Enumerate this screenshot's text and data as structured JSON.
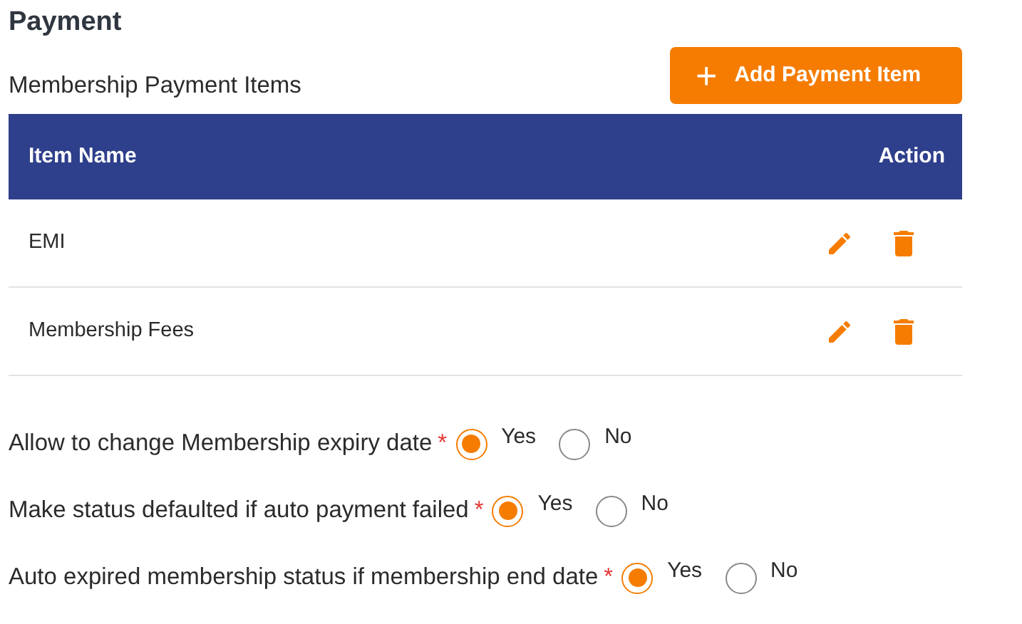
{
  "section_title": "Payment",
  "subtitle": "Membership Payment Items",
  "add_button": {
    "icon": "+",
    "label": "Add Payment Item"
  },
  "table": {
    "columns": [
      "Item Name",
      "Action"
    ],
    "rows": [
      {
        "name": "EMI"
      },
      {
        "name": "Membership Fees"
      }
    ]
  },
  "settings": [
    {
      "label": "Allow to change Membership expiry date",
      "required_mark": "*",
      "options": [
        {
          "label": "Yes",
          "selected": true
        },
        {
          "label": "No",
          "selected": false
        }
      ]
    },
    {
      "label": "Make status defaulted if auto payment failed",
      "required_mark": "*",
      "options": [
        {
          "label": "Yes",
          "selected": true
        },
        {
          "label": "No",
          "selected": false
        }
      ]
    },
    {
      "label": "Auto expired membership status if membership end date",
      "required_mark": "*",
      "options": [
        {
          "label": "Yes",
          "selected": true
        },
        {
          "label": "No",
          "selected": false
        }
      ]
    }
  ]
}
